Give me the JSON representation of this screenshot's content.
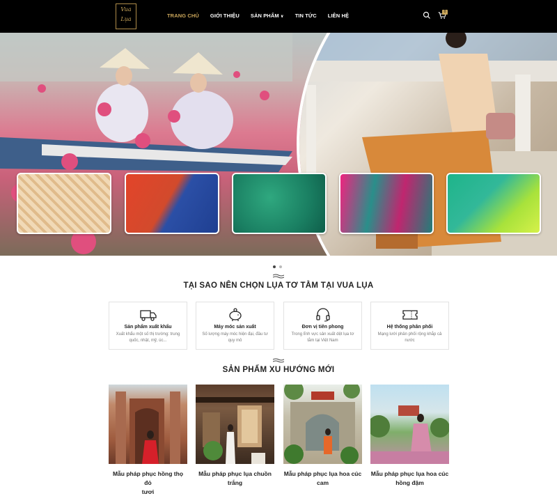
{
  "header": {
    "logo_line1": "Vua",
    "logo_line2": "Lụa",
    "nav": [
      {
        "label": "TRANG CHỦ",
        "active": true
      },
      {
        "label": "GIỚI THIỆU",
        "active": false
      },
      {
        "label": "SẢN PHẨM",
        "active": false,
        "has_dropdown": true
      },
      {
        "label": "TIN TỨC",
        "active": false
      },
      {
        "label": "LIÊN HỆ",
        "active": false
      }
    ],
    "cart_count": "0",
    "accent_color": "#c9a55a"
  },
  "hero": {
    "swatch_colors": [
      "#e8c99a",
      "#d2462a",
      "#1e8f6f",
      "#d02c7e",
      "#5fc7a0"
    ],
    "active_slide": 1,
    "slide_count": 2
  },
  "why": {
    "title": "TẠI SAO NÊN CHỌN LỤA TƠ TẰM TẠI VUA LỤA",
    "features": [
      {
        "icon": "truck-icon",
        "title": "Sản phẩm xuất khẩu",
        "desc": "Xuất khẩu một số thị trường: trung quốc, nhật, mỹ, úc..."
      },
      {
        "icon": "piggy-bank-icon",
        "title": "Máy móc sản xuất",
        "desc": "Số lượng máy móc hiện đại, đầu tư quy mô"
      },
      {
        "icon": "headset-icon",
        "title": "Đơn vị tiên phong",
        "desc": "Trong lĩnh vực sản xuất dệt lụa tơ tằm tại Việt Nam"
      },
      {
        "icon": "ticket-icon",
        "title": "Hệ thống phân phối",
        "desc": "Mạng lưới phân phối rộng khắp cả nước"
      }
    ]
  },
  "products": {
    "title": "SẢN PHẨM XU HƯỚNG MỚI",
    "items": [
      {
        "name_line1": "Mẫu pháp phục hồng thọ đỏ",
        "name_line2": "tươi"
      },
      {
        "name_line1": "Mẫu pháp phục lụa chuồn",
        "name_line2": "trắng"
      },
      {
        "name_line1": "Mẫu pháp phục lụa hoa cúc",
        "name_line2": "cam"
      },
      {
        "name_line1": "Mẫu pháp phục lụa hoa cúc",
        "name_line2": "hồng đậm"
      }
    ]
  }
}
